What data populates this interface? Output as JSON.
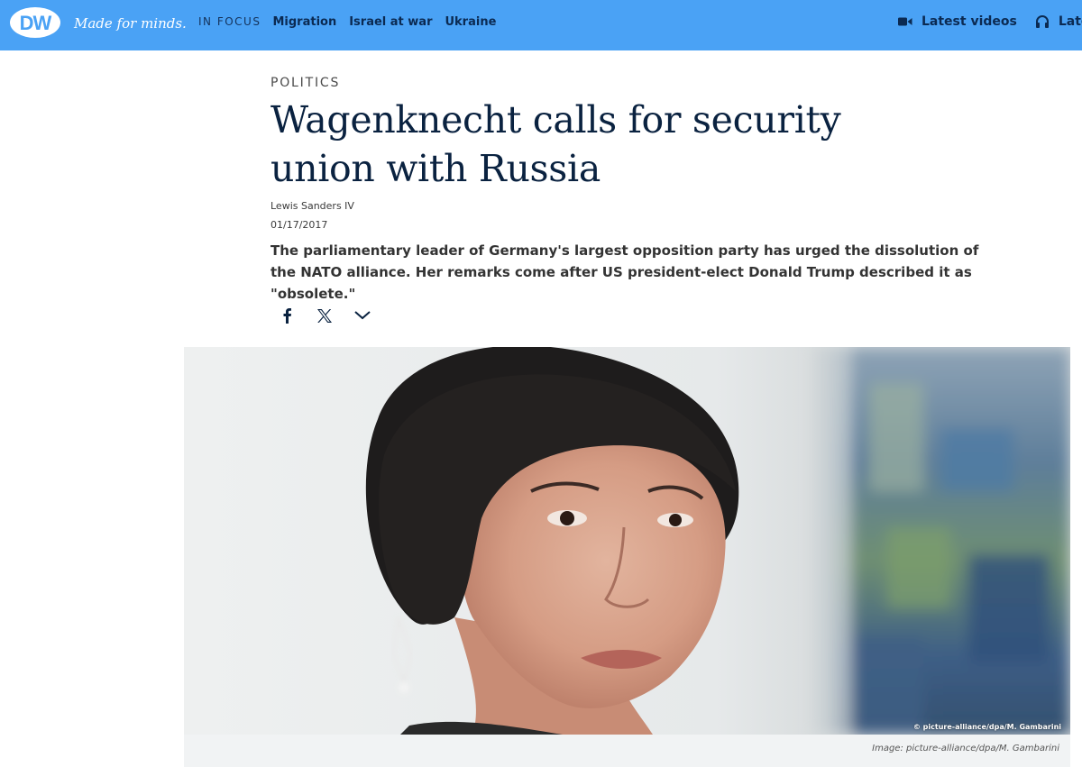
{
  "header": {
    "logo_text": "DW",
    "tagline": "Made for minds.",
    "in_focus_label": "IN FOCUS",
    "nav_links": [
      "Migration",
      "Israel at war",
      "Ukraine"
    ],
    "latest_videos": "Latest videos",
    "latest_audio_partial": "Lates",
    "background_color": "#4aa2f5"
  },
  "article": {
    "kicker": "POLITICS",
    "headline": "Wagenknecht calls for security union with Russia",
    "author": "Lewis Sanders IV",
    "date": "01/17/2017",
    "teaser": "The parliamentary leader of Germany's largest opposition party has urged the dissolution of the NATO alliance. Her remarks come after US president-elect Donald Trump described it as \"obsolete.\"",
    "headline_color": "#0a2240"
  },
  "share": {
    "icons": [
      "facebook-icon",
      "x-icon",
      "chevron-down-icon"
    ]
  },
  "image": {
    "overlay_credit": "© picture-alliance/dpa/M. Gambarini",
    "caption": "Image: picture-alliance/dpa/M. Gambarini"
  }
}
